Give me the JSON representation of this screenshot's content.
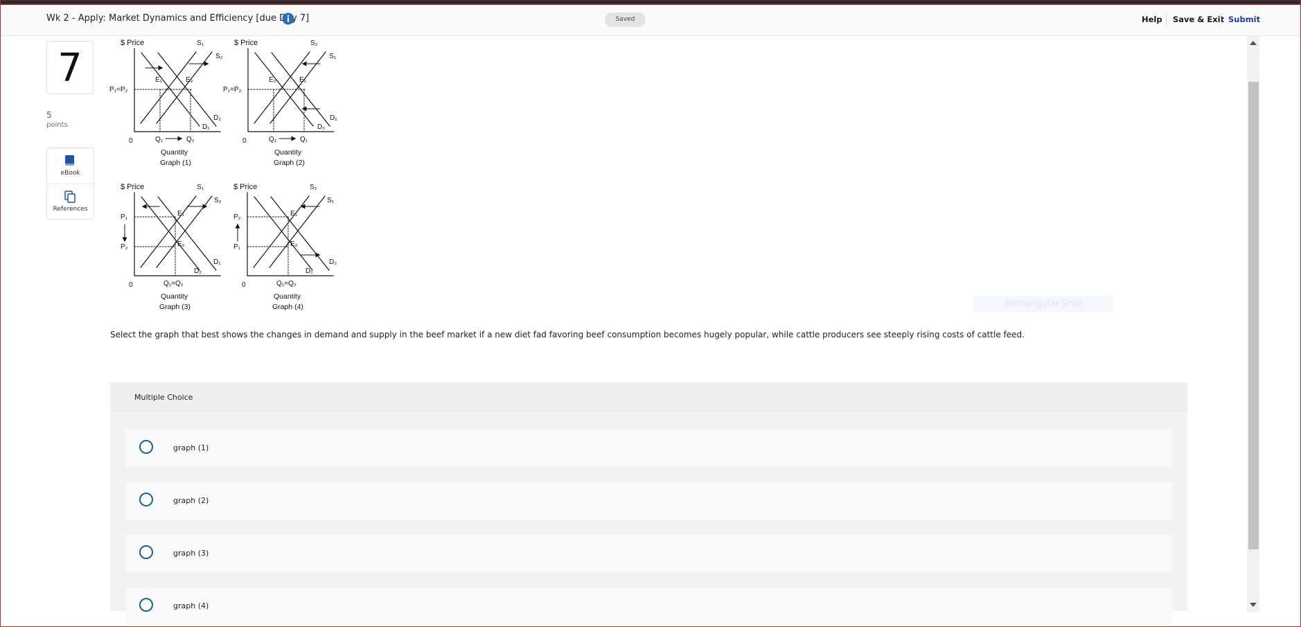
{
  "header": {
    "title": "Wk 2 - Apply: Market Dynamics and Efficiency [due Day 7]",
    "info_icon": "info-icon",
    "status": "Saved",
    "help": "Help",
    "save_exit": "Save & Exit",
    "submit": "Submit",
    "submit_color": "#1c3f8f"
  },
  "question": {
    "number": "7",
    "points_value": "5",
    "points_label": "points",
    "tools": [
      {
        "label": "eBook",
        "icon": "book-icon"
      },
      {
        "label": "References",
        "icon": "references-icon"
      }
    ],
    "text": "Select the graph that best shows the changes in demand and supply in the beef market if a new diet fad favoring beef consumption becomes hugely popular, while cattle producers see steeply rising costs of cattle feed."
  },
  "graphs": {
    "price_axis": "$ Price",
    "quantity_axis": "Quantity",
    "origin": "0",
    "g1": {
      "title": "Graph (1)",
      "price_label": "P₁=P₂",
      "q_a": "Q₁",
      "q_b": "Q₂",
      "s_a": "S₁",
      "s_b": "S₂",
      "d_a": "D₂",
      "d_b": "D₁",
      "e_a": "E₁",
      "e_b": "E₂"
    },
    "g2": {
      "title": "Graph (2)",
      "price_label": "P₁=P₂",
      "q_a": "Q₂",
      "q_b": "Q₁",
      "s_a": "S₂",
      "s_b": "S₁",
      "d_a": "D₁",
      "d_b": "D₂",
      "e_a": "E₂",
      "e_b": "E₁"
    },
    "g3": {
      "title": "Graph (3)",
      "p_top": "P₁",
      "p_bot": "P₂",
      "q": "Q₁=Q₂",
      "s_a": "S₁",
      "s_b": "S₂",
      "d_a": "D₁",
      "d_b": "D₂",
      "e_a": "E₁",
      "e_b": "E₂"
    },
    "g4": {
      "title": "Graph (4)",
      "p_top": "P₂",
      "p_bot": "P₁",
      "q": "Q₁=Q₂",
      "s_a": "S₂",
      "s_b": "S₁",
      "d_a": "D₂",
      "d_b": "D₁",
      "e_a": "E₁",
      "e_b": "E₂"
    }
  },
  "answer": {
    "type_label": "Multiple Choice",
    "options": [
      "graph (1)",
      "graph (2)",
      "graph (3)",
      "graph (4)"
    ]
  },
  "overlay": {
    "snip_text": "Rectangular Snip"
  }
}
